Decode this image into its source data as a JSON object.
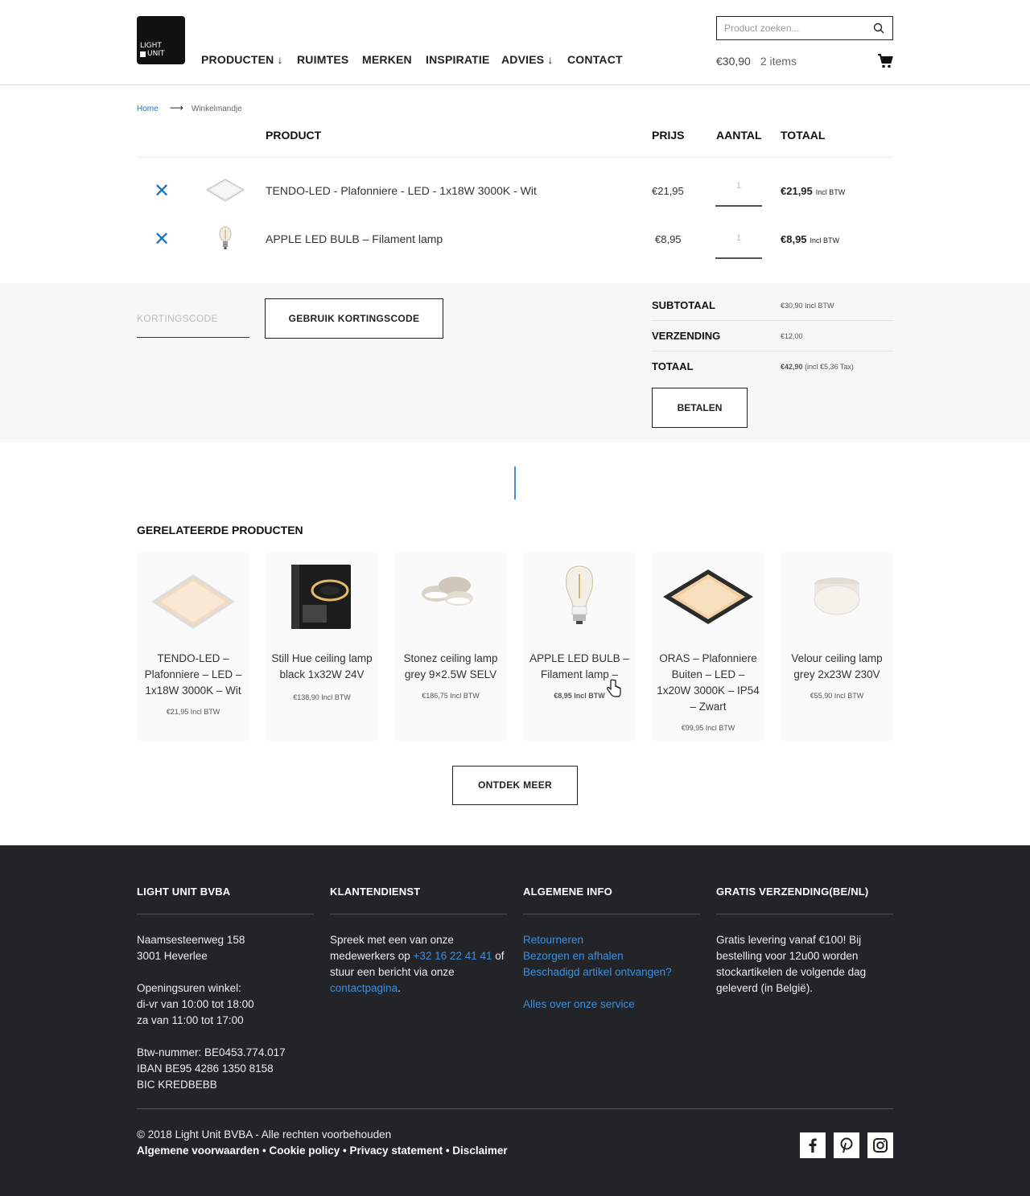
{
  "header": {
    "logo_top": "LIGHT",
    "logo_bottom": "UNIT",
    "nav": [
      "PRODUCTEN ↓",
      "RUIMTES",
      "MERKEN",
      "INSPIRATIE",
      "ADVIES ↓",
      "CONTACT"
    ],
    "search_placeholder": "Product zoeken...",
    "cart_total": "€30,90",
    "cart_items": "2 items"
  },
  "breadcrumb": {
    "home": "Home",
    "current": "Winkelmandje"
  },
  "cart": {
    "headers": {
      "product": "PRODUCT",
      "price": "PRIJS",
      "qty": "AANTAL",
      "total": "TOTAAL"
    },
    "rows": [
      {
        "name": "TENDO-LED - Plafonniere - LED - 1x18W 3000K - Wit",
        "price": "€21,95",
        "qty": "1",
        "total": "€21,95",
        "tax": "Incl BTW",
        "remove": "✕"
      },
      {
        "name": "APPLE LED BULB – Filament lamp",
        "price": "€8,95",
        "qty": "1",
        "total": "€8,95",
        "tax": "Incl BTW",
        "remove": "✕"
      }
    ],
    "coupon_placeholder": "KORTINGSCODE",
    "coupon_button": "GEBRUIK KORTINGSCODE",
    "totals": {
      "subtotal_label": "SUBTOTAAL",
      "subtotal_value": "€30,90 Incl BTW",
      "shipping_label": "VERZENDING",
      "shipping_value": "€12,00",
      "total_label": "TOTAAL",
      "total_value_bold": "€42,90",
      "total_value_note": "(incl €5,36 Tax)"
    },
    "pay_button": "BETALEN"
  },
  "related": {
    "title": "GERELATEERDE PRODUCTEN",
    "items": [
      {
        "name": "TENDO-LED – Plafonniere – LED – 1x18W 3000K – Wit",
        "price": "€21,95 Incl BTW"
      },
      {
        "name": "Still Hue ceiling lamp black 1x32W 24V",
        "price": "€138,90 Incl BTW"
      },
      {
        "name": "Stonez ceiling lamp grey 9×2.5W SELV",
        "price": "€186,75 Incl BTW"
      },
      {
        "name": "APPLE LED BULB – Filament lamp –",
        "price": "€8,95 Incl BTW"
      },
      {
        "name": "ORAS – Plafonniere Buiten – LED – 1x20W 3000K – IP54 – Zwart",
        "price": "€99,95 Incl BTW"
      },
      {
        "name": "Velour ceiling lamp grey 2x23W 230V",
        "price": "€55,90 Incl BTW"
      }
    ],
    "more_button": "ONTDEK MEER"
  },
  "footer": {
    "col1": {
      "title": "LIGHT UNIT BVBA",
      "lines": [
        "Naamsesteenweg 158",
        "3001 Heverlee",
        "",
        "Openingsuren winkel:",
        "di-vr van 10:00 tot 18:00",
        "za van 11:00 tot 17:00",
        "",
        "Btw-nummer: BE0453.774.017",
        "IBAN BE95 4286 1350 8158",
        "BIC KREDBEBB"
      ]
    },
    "col2": {
      "title": "KLANTENDIENST",
      "t1": "Spreek met een van onze medewerkers op ",
      "phone": "+32 16 22 41 41",
      "t2": " of stuur een bericht via onze ",
      "link": "contactpagina",
      "t3": "."
    },
    "col3": {
      "title": "ALGEMENE INFO",
      "links": [
        "Retourneren",
        "Bezorgen en afhalen",
        "Beschadigd artikel ontvangen?"
      ],
      "service": "Alles over onze service"
    },
    "col4": {
      "title": "GRATIS VERZENDING(BE/NL)",
      "text": "Gratis levering vanaf €100! Bij bestelling voor 12u00 worden stockartikelen de volgende dag geleverd (in België)."
    },
    "copyright": "© 2018 Light Unit BVBA - Alle rechten voorbehouden",
    "legal": "Algemene voorwaarden • Cookie policy • Privacy statement • Disclaimer",
    "social": [
      "facebook-icon",
      "pinterest-icon",
      "instagram-icon"
    ]
  },
  "colors": {
    "accent": "#1e73be",
    "footer_bg": "#232427"
  }
}
